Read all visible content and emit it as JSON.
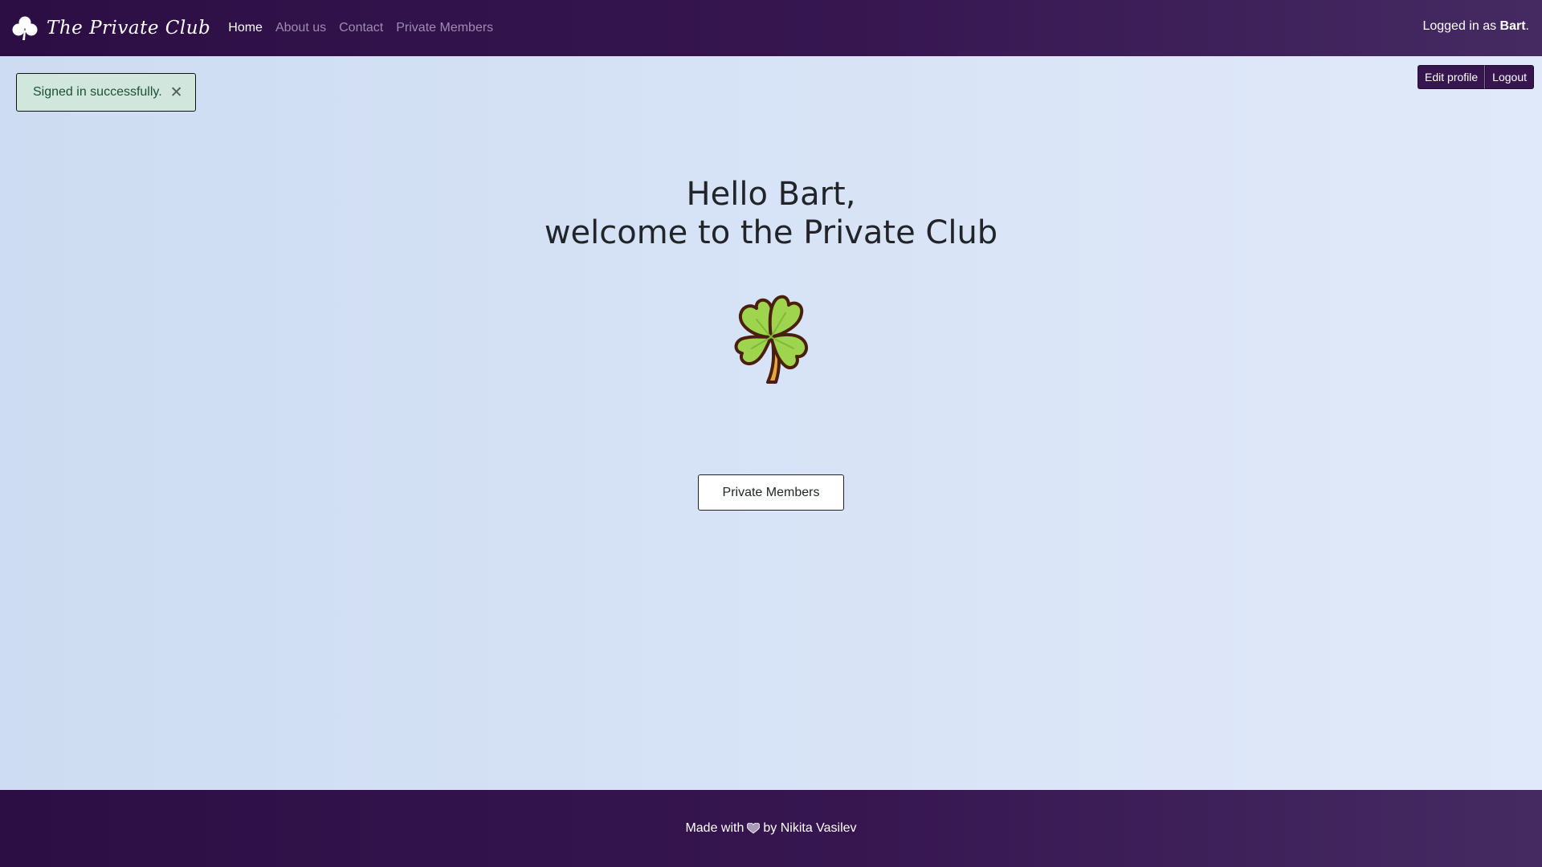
{
  "navbar": {
    "brand_text": "The Private Club",
    "brand_icon": "clover-icon",
    "links": [
      {
        "label": "Home",
        "active": true
      },
      {
        "label": "About us",
        "active": false
      },
      {
        "label": "Contact",
        "active": false
      },
      {
        "label": "Private Members",
        "active": false
      }
    ],
    "user_prefix": "Logged in as ",
    "user_name": "Bart",
    "user_suffix": "."
  },
  "alert": {
    "message": "Signed in successfully.",
    "close_glyph": "✕"
  },
  "account": {
    "edit_profile_label": "Edit profile",
    "logout_label": "Logout"
  },
  "hero": {
    "greeting": "Hello Bart,",
    "welcome": "welcome to the Private Club",
    "image_icon": "four-leaf-clover-icon",
    "button_label": "Private Members"
  },
  "footer": {
    "made_with": "Made with",
    "heart_icon": "heart-icon",
    "by_text": "by Nikita Vasilev"
  },
  "colors": {
    "navbar_bg": "#371650",
    "page_bg": "#d7e3f6",
    "alert_bg": "#d1e7dd",
    "alert_text": "#1c5131",
    "clover_green": "#9fd44f",
    "clover_outline": "#4a1f0e"
  }
}
